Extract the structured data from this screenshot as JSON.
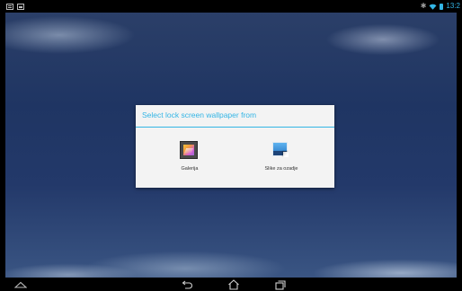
{
  "status_bar": {
    "left_icons": [
      "notification-note-icon",
      "screenshot-icon"
    ],
    "right_icons": [
      "bluetooth-icon",
      "wifi-icon",
      "battery-icon"
    ],
    "clock": "13:2",
    "accent_color": "#33b5e5"
  },
  "dialog": {
    "title": "Select lock screen wallpaper from",
    "options": [
      {
        "label": "Galerija",
        "icon": "gallery-icon"
      },
      {
        "label": "Slike za ozadje",
        "icon": "wallpapers-icon"
      }
    ]
  },
  "nav_bar": {
    "buttons": [
      "collapse-icon",
      "back-icon",
      "home-icon",
      "recent-apps-icon"
    ]
  }
}
